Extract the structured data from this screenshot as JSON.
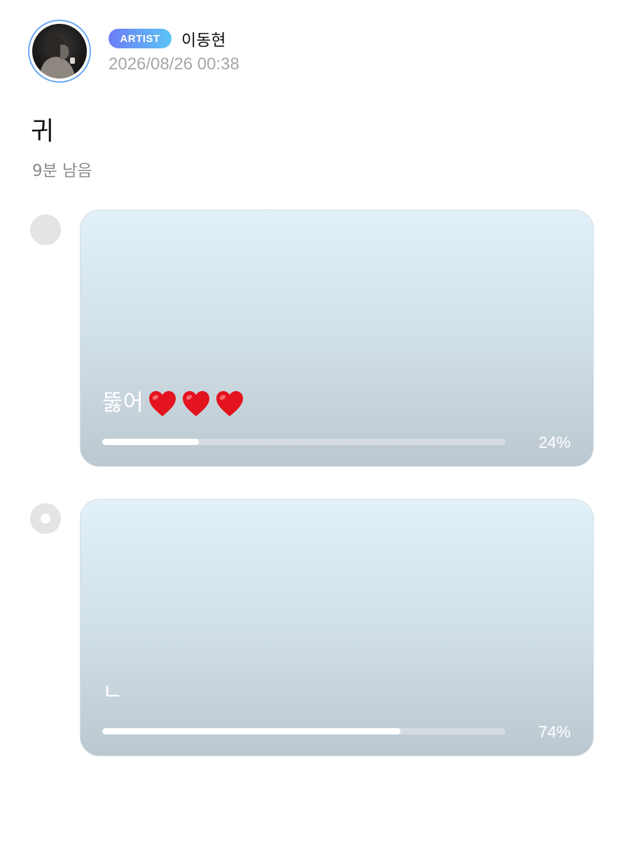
{
  "post": {
    "badge": "ARTIST",
    "author": "이동현",
    "timestamp": "2026/08/26 00:38",
    "avatar_icon": "profile-photo",
    "accent_color": "#6aa8f0"
  },
  "poll": {
    "question": "귀",
    "remaining": "9분 남음",
    "options": [
      {
        "text": "뚫어",
        "emoji": [
          "heart-icon",
          "heart-icon",
          "heart-icon"
        ],
        "percent_label": "24%",
        "percent": 24,
        "selected": false
      },
      {
        "text": "ㄴ",
        "emoji": [],
        "percent_label": "74%",
        "percent": 74,
        "selected": true
      }
    ]
  }
}
